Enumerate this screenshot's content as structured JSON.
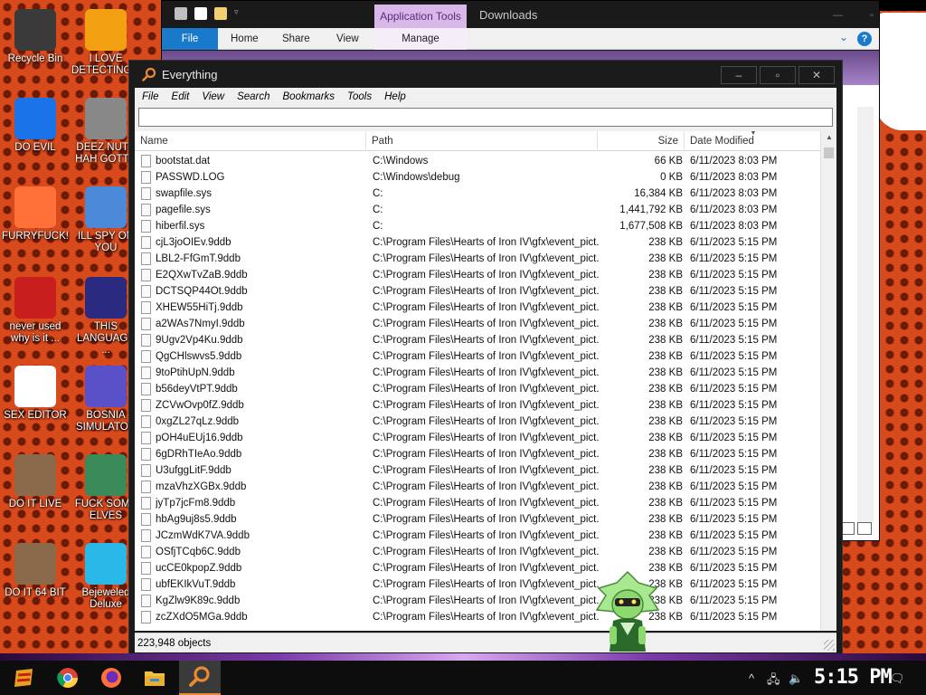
{
  "desktop": {
    "icons": [
      {
        "label": "Recycle Bin",
        "icon": "recycle-bin-icon",
        "color": "#3a3a3a"
      },
      {
        "label": "I LOVE DETECTING...",
        "icon": "detective-app-icon",
        "color": "#f0a010"
      },
      {
        "label": "DO EVIL",
        "icon": "chrome-icon",
        "color": "#1a73e8"
      },
      {
        "label": "DEEZ NUTS HAH GOTT...",
        "icon": "windows-stack-icon",
        "color": "#888888"
      },
      {
        "label": "FURRYFUCK!",
        "icon": "firefox-icon",
        "color": "#ff7139"
      },
      {
        "label": "ILL SPY ON YOU",
        "icon": "spy-network-icon",
        "color": "#4a8ad8"
      },
      {
        "label": "never used why is it ...",
        "icon": "dev-cpp-icon",
        "color": "#c81e1e"
      },
      {
        "label": "THIS LANGUAGE ...",
        "icon": "goland-icon",
        "color": "#2a2a80"
      },
      {
        "label": "SEX EDITOR",
        "icon": "hxd-hex-editor-icon",
        "color": "#ffffff"
      },
      {
        "label": "BOSNIA SIMULATOR",
        "icon": "bomb-game-icon",
        "color": "#5a50c8"
      },
      {
        "label": "DO IT LIVE",
        "icon": "portrait-app-icon",
        "color": "#8a6a4a"
      },
      {
        "label": "FUCK SOME ELVES",
        "icon": "elf-game-icon",
        "color": "#3a8a5a"
      },
      {
        "label": "DO IT 64 BIT",
        "icon": "portrait-64-app-icon",
        "color": "#8a6a4a"
      },
      {
        "label": "Bejeweled Deluxe",
        "icon": "bejeweled-gem-icon",
        "color": "#2ab8e8"
      }
    ]
  },
  "explorer": {
    "app_tools_tab": "Application Tools",
    "title": "Downloads",
    "tabs": [
      "File",
      "Home",
      "Share",
      "View",
      "Manage"
    ]
  },
  "everything": {
    "title": "Everything",
    "window_buttons": {
      "minimize": "–",
      "maximize": "▫",
      "close": "✕"
    },
    "menu": [
      "File",
      "Edit",
      "View",
      "Search",
      "Bookmarks",
      "Tools",
      "Help"
    ],
    "search_value": "",
    "columns": {
      "name": "Name",
      "path": "Path",
      "size": "Size",
      "date": "Date Modified"
    },
    "rows": [
      {
        "name": "bootstat.dat",
        "path": "C:\\Windows",
        "size": "66 KB",
        "date": "6/11/2023 8:03 PM"
      },
      {
        "name": "PASSWD.LOG",
        "path": "C:\\Windows\\debug",
        "size": "0 KB",
        "date": "6/11/2023 8:03 PM"
      },
      {
        "name": "swapfile.sys",
        "path": "C:",
        "size": "16,384 KB",
        "date": "6/11/2023 8:03 PM"
      },
      {
        "name": "pagefile.sys",
        "path": "C:",
        "size": "1,441,792 KB",
        "date": "6/11/2023 8:03 PM"
      },
      {
        "name": "hiberfil.sys",
        "path": "C:",
        "size": "1,677,508 KB",
        "date": "6/11/2023 8:03 PM"
      },
      {
        "name": "cjL3joOIEv.9ddb",
        "path": "C:\\Program Files\\Hearts of Iron IV\\gfx\\event_pict...",
        "size": "238 KB",
        "date": "6/11/2023 5:15 PM"
      },
      {
        "name": "LBL2-FfGmT.9ddb",
        "path": "C:\\Program Files\\Hearts of Iron IV\\gfx\\event_pict...",
        "size": "238 KB",
        "date": "6/11/2023 5:15 PM"
      },
      {
        "name": "E2QXwTvZaB.9ddb",
        "path": "C:\\Program Files\\Hearts of Iron IV\\gfx\\event_pict...",
        "size": "238 KB",
        "date": "6/11/2023 5:15 PM"
      },
      {
        "name": "DCTSQP44Ot.9ddb",
        "path": "C:\\Program Files\\Hearts of Iron IV\\gfx\\event_pict...",
        "size": "238 KB",
        "date": "6/11/2023 5:15 PM"
      },
      {
        "name": "XHEW55HiTj.9ddb",
        "path": "C:\\Program Files\\Hearts of Iron IV\\gfx\\event_pict...",
        "size": "238 KB",
        "date": "6/11/2023 5:15 PM"
      },
      {
        "name": "a2WAs7NmyI.9ddb",
        "path": "C:\\Program Files\\Hearts of Iron IV\\gfx\\event_pict...",
        "size": "238 KB",
        "date": "6/11/2023 5:15 PM"
      },
      {
        "name": "9Ugv2Vp4Ku.9ddb",
        "path": "C:\\Program Files\\Hearts of Iron IV\\gfx\\event_pict...",
        "size": "238 KB",
        "date": "6/11/2023 5:15 PM"
      },
      {
        "name": "QgCHlswvs5.9ddb",
        "path": "C:\\Program Files\\Hearts of Iron IV\\gfx\\event_pict...",
        "size": "238 KB",
        "date": "6/11/2023 5:15 PM"
      },
      {
        "name": "9toPtihUpN.9ddb",
        "path": "C:\\Program Files\\Hearts of Iron IV\\gfx\\event_pict...",
        "size": "238 KB",
        "date": "6/11/2023 5:15 PM"
      },
      {
        "name": "b56deyVtPT.9ddb",
        "path": "C:\\Program Files\\Hearts of Iron IV\\gfx\\event_pict...",
        "size": "238 KB",
        "date": "6/11/2023 5:15 PM"
      },
      {
        "name": "ZCVwOvp0fZ.9ddb",
        "path": "C:\\Program Files\\Hearts of Iron IV\\gfx\\event_pict...",
        "size": "238 KB",
        "date": "6/11/2023 5:15 PM"
      },
      {
        "name": "0xgZL27qLz.9ddb",
        "path": "C:\\Program Files\\Hearts of Iron IV\\gfx\\event_pict...",
        "size": "238 KB",
        "date": "6/11/2023 5:15 PM"
      },
      {
        "name": "pOH4uEUj16.9ddb",
        "path": "C:\\Program Files\\Hearts of Iron IV\\gfx\\event_pict...",
        "size": "238 KB",
        "date": "6/11/2023 5:15 PM"
      },
      {
        "name": "6gDRhTIeAo.9ddb",
        "path": "C:\\Program Files\\Hearts of Iron IV\\gfx\\event_pict...",
        "size": "238 KB",
        "date": "6/11/2023 5:15 PM"
      },
      {
        "name": "U3ufggLitF.9ddb",
        "path": "C:\\Program Files\\Hearts of Iron IV\\gfx\\event_pict...",
        "size": "238 KB",
        "date": "6/11/2023 5:15 PM"
      },
      {
        "name": "mzaVhzXGBx.9ddb",
        "path": "C:\\Program Files\\Hearts of Iron IV\\gfx\\event_pict...",
        "size": "238 KB",
        "date": "6/11/2023 5:15 PM"
      },
      {
        "name": "jyTp7jcFm8.9ddb",
        "path": "C:\\Program Files\\Hearts of Iron IV\\gfx\\event_pict...",
        "size": "238 KB",
        "date": "6/11/2023 5:15 PM"
      },
      {
        "name": "hbAg9uj8s5.9ddb",
        "path": "C:\\Program Files\\Hearts of Iron IV\\gfx\\event_pict...",
        "size": "238 KB",
        "date": "6/11/2023 5:15 PM"
      },
      {
        "name": "JCzmWdK7VA.9ddb",
        "path": "C:\\Program Files\\Hearts of Iron IV\\gfx\\event_pict...",
        "size": "238 KB",
        "date": "6/11/2023 5:15 PM"
      },
      {
        "name": "OSfjTCqb6C.9ddb",
        "path": "C:\\Program Files\\Hearts of Iron IV\\gfx\\event_pict...",
        "size": "238 KB",
        "date": "6/11/2023 5:15 PM"
      },
      {
        "name": "ucCE0kpopZ.9ddb",
        "path": "C:\\Program Files\\Hearts of Iron IV\\gfx\\event_pict...",
        "size": "238 KB",
        "date": "6/11/2023 5:15 PM"
      },
      {
        "name": "ubfEKIkVuT.9ddb",
        "path": "C:\\Program Files\\Hearts of Iron IV\\gfx\\event_pict...",
        "size": "238 KB",
        "date": "6/11/2023 5:15 PM"
      },
      {
        "name": "KgZlw9K89c.9ddb",
        "path": "C:\\Program Files\\Hearts of Iron IV\\gfx\\event_pict...",
        "size": "238 KB",
        "date": "6/11/2023 5:15 PM"
      },
      {
        "name": "zcZXdO5MGa.9ddb",
        "path": "C:\\Program Files\\Hearts of Iron IV\\gfx\\event_pict...",
        "size": "238 KB",
        "date": "6/11/2023 5:15 PM"
      }
    ],
    "status": "223,948 objects"
  },
  "taskbar": {
    "items": [
      "start-button",
      "chrome-icon",
      "firefox-icon",
      "file-explorer-icon",
      "everything-search-icon"
    ],
    "clock": "5:15 PM"
  },
  "colors": {
    "accent_blue": "#1979ca",
    "explorer_tools": "#d8b8e8",
    "everything_orange": "#e88a30"
  }
}
